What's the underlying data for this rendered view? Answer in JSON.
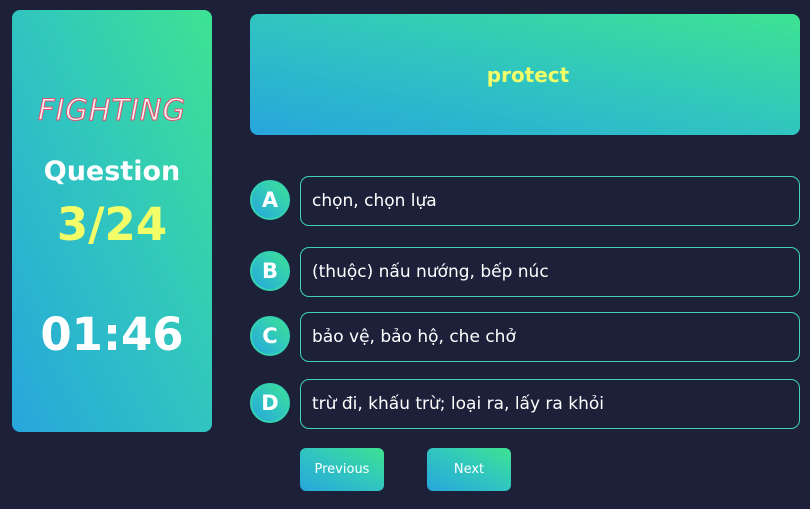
{
  "sidebar": {
    "motto": "FIGHTING",
    "question_label": "Question",
    "question_counter": "3/24",
    "timer": "01:46"
  },
  "word": "protect",
  "options": [
    {
      "letter": "A",
      "text": "chọn, chọn lựa"
    },
    {
      "letter": "B",
      "text": "(thuộc) nấu nướng, bếp núc"
    },
    {
      "letter": "C",
      "text": "bảo vệ, bảo hộ, che chở"
    },
    {
      "letter": "D",
      "text": "trừ đi, khấu trừ; loại ra, lấy ra khỏi"
    }
  ],
  "navigation": {
    "previous_label": "Previous",
    "next_label": "Next"
  },
  "colors": {
    "background": "#1c2039",
    "gradient_start": "#27a6dc",
    "gradient_end": "#3de392",
    "highlight_yellow": "#f2fd67",
    "option_border": "#3fd4b4"
  }
}
